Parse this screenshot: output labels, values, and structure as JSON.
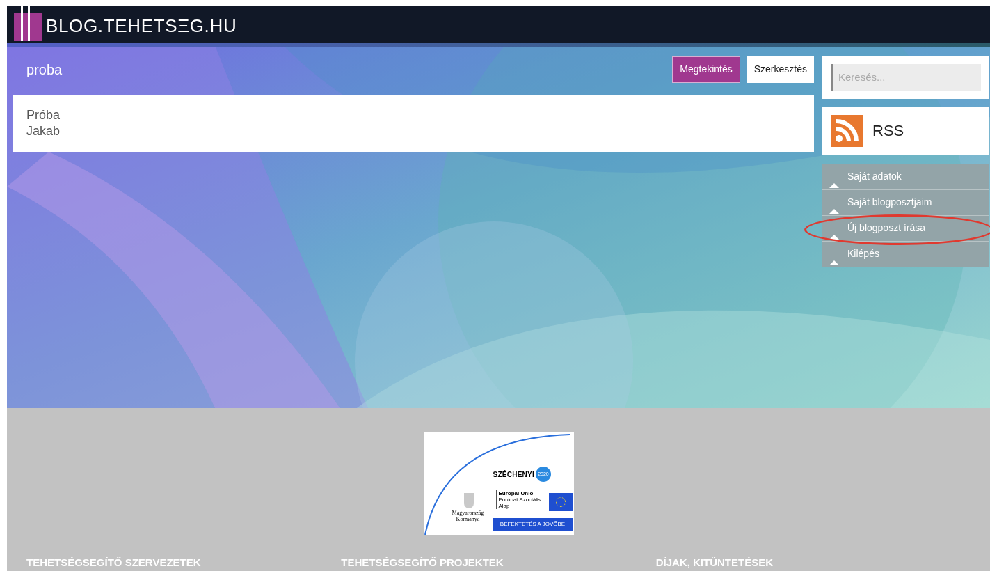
{
  "header": {
    "logo_text": "BLOG.TEHETSΞG.HU"
  },
  "post": {
    "title": "proba",
    "actions": [
      {
        "label": "Megtekintés",
        "selected": true
      },
      {
        "label": "Szerkesztés",
        "selected": false
      }
    ],
    "body_lines": [
      "Próba",
      "Jakab"
    ]
  },
  "sidebar": {
    "search": {
      "placeholder": "Keresés..."
    },
    "rss": {
      "label": "RSS"
    },
    "menu": [
      {
        "label": "Saját adatok",
        "circled": false
      },
      {
        "label": "Saját blogposztjaim",
        "circled": false
      },
      {
        "label": "Új blogposzt írása",
        "circled": true
      },
      {
        "label": "Kilépés",
        "circled": false
      }
    ]
  },
  "footer": {
    "sponsor": {
      "brand": "SZÉCHENYI",
      "year": "2020",
      "eu_lines": [
        "Európai Unió",
        "Európai Szociális",
        "Alap"
      ],
      "gov_lines": [
        "Magyarország",
        "Kormánya"
      ],
      "slogan": "BEFEKTETÉS A JÖVŐBE"
    },
    "columns": [
      "TEHETSÉGSEGÍTŐ SZERVEZETEK",
      "TEHETSÉGSEGÍTŐ PROJEKTEK",
      "DÍJAK, KITÜNTETÉSEK"
    ]
  }
}
